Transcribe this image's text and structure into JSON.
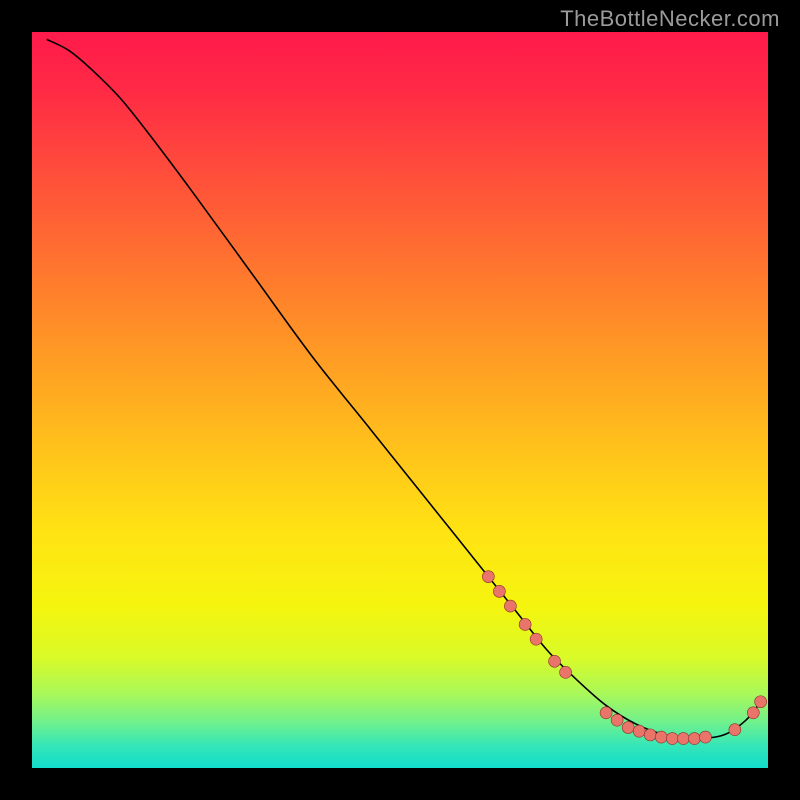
{
  "watermark_text": "TheBottleNecker.com",
  "chart_data": {
    "type": "line",
    "title": "",
    "xlabel": "",
    "ylabel": "",
    "xlim": [
      0,
      100
    ],
    "ylim": [
      0,
      100
    ],
    "curve": {
      "name": "bottleneck-curve",
      "x": [
        2,
        5,
        8,
        12,
        16,
        22,
        30,
        38,
        46,
        54,
        62,
        66,
        70,
        74,
        78,
        82,
        86,
        90,
        94,
        97,
        99
      ],
      "y": [
        99,
        97.5,
        95,
        91,
        86,
        78,
        67,
        56,
        46,
        36,
        26,
        21,
        16,
        12,
        8.5,
        6,
        4.5,
        4,
        4.5,
        6.5,
        9
      ]
    },
    "markers": [
      {
        "x": 62,
        "y": 26,
        "r": 6
      },
      {
        "x": 63.5,
        "y": 24,
        "r": 6
      },
      {
        "x": 65,
        "y": 22,
        "r": 6
      },
      {
        "x": 67,
        "y": 19.5,
        "r": 6
      },
      {
        "x": 68.5,
        "y": 17.5,
        "r": 6
      },
      {
        "x": 71,
        "y": 14.5,
        "r": 6
      },
      {
        "x": 72.5,
        "y": 13,
        "r": 6
      },
      {
        "x": 78,
        "y": 7.5,
        "r": 6
      },
      {
        "x": 79.5,
        "y": 6.5,
        "r": 6
      },
      {
        "x": 81,
        "y": 5.5,
        "r": 6
      },
      {
        "x": 82.5,
        "y": 5,
        "r": 6
      },
      {
        "x": 84,
        "y": 4.5,
        "r": 6
      },
      {
        "x": 85.5,
        "y": 4.2,
        "r": 6
      },
      {
        "x": 87,
        "y": 4,
        "r": 6
      },
      {
        "x": 88.5,
        "y": 4,
        "r": 6
      },
      {
        "x": 90,
        "y": 4,
        "r": 6
      },
      {
        "x": 91.5,
        "y": 4.2,
        "r": 6
      },
      {
        "x": 95.5,
        "y": 5.2,
        "r": 6
      },
      {
        "x": 98,
        "y": 7.5,
        "r": 6
      },
      {
        "x": 99,
        "y": 9,
        "r": 6
      }
    ],
    "gradient_stops": [
      {
        "offset": 0.0,
        "color": "#ff1a4b"
      },
      {
        "offset": 0.08,
        "color": "#ff2a45"
      },
      {
        "offset": 0.18,
        "color": "#ff4a3c"
      },
      {
        "offset": 0.3,
        "color": "#ff6f30"
      },
      {
        "offset": 0.42,
        "color": "#ff9526"
      },
      {
        "offset": 0.55,
        "color": "#ffbd1c"
      },
      {
        "offset": 0.68,
        "color": "#ffe313"
      },
      {
        "offset": 0.78,
        "color": "#f5f50e"
      },
      {
        "offset": 0.85,
        "color": "#d9fb28"
      },
      {
        "offset": 0.9,
        "color": "#a8f85a"
      },
      {
        "offset": 0.94,
        "color": "#6cf090"
      },
      {
        "offset": 0.97,
        "color": "#34e6b8"
      },
      {
        "offset": 1.0,
        "color": "#12dccc"
      }
    ],
    "marker_color": "#e9746a",
    "marker_stroke": "#8a2f28"
  }
}
